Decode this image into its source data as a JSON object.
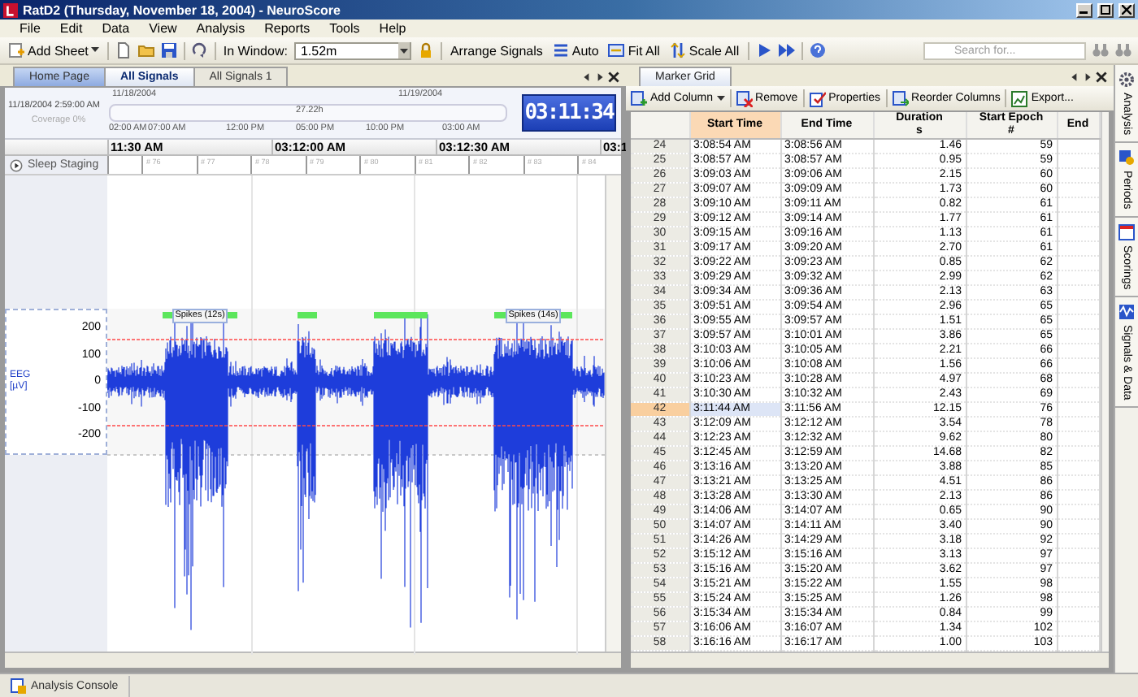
{
  "window": {
    "title": "RatD2 (Thursday, November 18, 2004) - NeuroScore"
  },
  "menu": [
    "File",
    "Edit",
    "Data",
    "View",
    "Analysis",
    "Reports",
    "Tools",
    "Help"
  ],
  "toolbar": {
    "add_sheet": "Add Sheet",
    "in_window_label": "In Window:",
    "in_window_value": "1.52m",
    "arrange": "Arrange Signals",
    "auto": "Auto",
    "fit_all": "Fit All",
    "scale_all": "Scale All",
    "search": {
      "placeholder": "Search for..."
    }
  },
  "left_tabs": [
    {
      "label": "Home Page",
      "selected": false
    },
    {
      "label": "All Signals",
      "selected": true
    },
    {
      "label": "All Signals 1",
      "selected": false
    }
  ],
  "overview": {
    "start": "11/18/2004 2:59:00 AM",
    "coverage": "Coverage 0%",
    "date_1": "11/18/2004",
    "date_2": "11/19/2004",
    "span": "27.22h",
    "ticks": [
      "02:00 AM",
      "07:00 AM",
      "12:00 PM",
      "05:00 PM",
      "10:00 PM",
      "03:00 AM"
    ],
    "clock": "03:11:34"
  },
  "time_axis": [
    "11:30 AM",
    "03:12:00 AM",
    "03:12:30 AM",
    "03:1"
  ],
  "sleep_staging": {
    "label": "Sleep Staging",
    "epochs": [
      "# 76",
      "# 77",
      "# 78",
      "# 79",
      "# 80",
      "# 81",
      "# 82",
      "# 83",
      "# 84"
    ]
  },
  "eeg": {
    "label": "EEG",
    "unit": "[µV]",
    "y_ticks": [
      "200",
      "100",
      "0",
      "-100",
      "-200"
    ],
    "markers": [
      {
        "kind": "labeled",
        "label": "Spikes (12s)"
      },
      {
        "kind": "bar"
      },
      {
        "kind": "bar"
      },
      {
        "kind": "labeled",
        "label": "Spikes (14s)"
      }
    ]
  },
  "right_tabs": [
    {
      "label": "Marker Grid",
      "selected": true
    }
  ],
  "grid_toolbar": [
    "Add Column",
    "Remove",
    "Properties",
    "Reorder Columns",
    "Export..."
  ],
  "grid": {
    "columns": [
      {
        "title": "Start Time",
        "selected": true
      },
      {
        "title": "End Time",
        "selected": false
      },
      {
        "title": "Duration",
        "unit": "s",
        "selected": false
      },
      {
        "title": "Start Epoch",
        "unit": "#",
        "selected": false
      },
      {
        "title": "End",
        "selected": false
      }
    ],
    "rows": [
      {
        "n": "24",
        "start": "3:08:54 AM",
        "end": "3:08:56 AM",
        "duration": "1.46",
        "epoch": "59",
        "selected": false
      },
      {
        "n": "25",
        "start": "3:08:57 AM",
        "end": "3:08:57 AM",
        "duration": "0.95",
        "epoch": "59",
        "selected": false
      },
      {
        "n": "26",
        "start": "3:09:03 AM",
        "end": "3:09:06 AM",
        "duration": "2.15",
        "epoch": "60",
        "selected": false
      },
      {
        "n": "27",
        "start": "3:09:07 AM",
        "end": "3:09:09 AM",
        "duration": "1.73",
        "epoch": "60",
        "selected": false
      },
      {
        "n": "28",
        "start": "3:09:10 AM",
        "end": "3:09:11 AM",
        "duration": "0.82",
        "epoch": "61",
        "selected": false
      },
      {
        "n": "29",
        "start": "3:09:12 AM",
        "end": "3:09:14 AM",
        "duration": "1.77",
        "epoch": "61",
        "selected": false
      },
      {
        "n": "30",
        "start": "3:09:15 AM",
        "end": "3:09:16 AM",
        "duration": "1.13",
        "epoch": "61",
        "selected": false
      },
      {
        "n": "31",
        "start": "3:09:17 AM",
        "end": "3:09:20 AM",
        "duration": "2.70",
        "epoch": "61",
        "selected": false
      },
      {
        "n": "32",
        "start": "3:09:22 AM",
        "end": "3:09:23 AM",
        "duration": "0.85",
        "epoch": "62",
        "selected": false
      },
      {
        "n": "33",
        "start": "3:09:29 AM",
        "end": "3:09:32 AM",
        "duration": "2.99",
        "epoch": "62",
        "selected": false
      },
      {
        "n": "34",
        "start": "3:09:34 AM",
        "end": "3:09:36 AM",
        "duration": "2.13",
        "epoch": "63",
        "selected": false
      },
      {
        "n": "35",
        "start": "3:09:51 AM",
        "end": "3:09:54 AM",
        "duration": "2.96",
        "epoch": "65",
        "selected": false
      },
      {
        "n": "36",
        "start": "3:09:55 AM",
        "end": "3:09:57 AM",
        "duration": "1.51",
        "epoch": "65",
        "selected": false
      },
      {
        "n": "37",
        "start": "3:09:57 AM",
        "end": "3:10:01 AM",
        "duration": "3.86",
        "epoch": "65",
        "selected": false
      },
      {
        "n": "38",
        "start": "3:10:03 AM",
        "end": "3:10:05 AM",
        "duration": "2.21",
        "epoch": "66",
        "selected": false
      },
      {
        "n": "39",
        "start": "3:10:06 AM",
        "end": "3:10:08 AM",
        "duration": "1.56",
        "epoch": "66",
        "selected": false
      },
      {
        "n": "40",
        "start": "3:10:23 AM",
        "end": "3:10:28 AM",
        "duration": "4.97",
        "epoch": "68",
        "selected": false
      },
      {
        "n": "41",
        "start": "3:10:30 AM",
        "end": "3:10:32 AM",
        "duration": "2.43",
        "epoch": "69",
        "selected": false
      },
      {
        "n": "42",
        "start": "3:11:44 AM",
        "end": "3:11:56 AM",
        "duration": "12.15",
        "epoch": "76",
        "selected": true
      },
      {
        "n": "43",
        "start": "3:12:09 AM",
        "end": "3:12:12 AM",
        "duration": "3.54",
        "epoch": "78",
        "selected": false
      },
      {
        "n": "44",
        "start": "3:12:23 AM",
        "end": "3:12:32 AM",
        "duration": "9.62",
        "epoch": "80",
        "selected": false
      },
      {
        "n": "45",
        "start": "3:12:45 AM",
        "end": "3:12:59 AM",
        "duration": "14.68",
        "epoch": "82",
        "selected": false
      },
      {
        "n": "46",
        "start": "3:13:16 AM",
        "end": "3:13:20 AM",
        "duration": "3.88",
        "epoch": "85",
        "selected": false
      },
      {
        "n": "47",
        "start": "3:13:21 AM",
        "end": "3:13:25 AM",
        "duration": "4.51",
        "epoch": "86",
        "selected": false
      },
      {
        "n": "48",
        "start": "3:13:28 AM",
        "end": "3:13:30 AM",
        "duration": "2.13",
        "epoch": "86",
        "selected": false
      },
      {
        "n": "49",
        "start": "3:14:06 AM",
        "end": "3:14:07 AM",
        "duration": "0.65",
        "epoch": "90",
        "selected": false
      },
      {
        "n": "50",
        "start": "3:14:07 AM",
        "end": "3:14:11 AM",
        "duration": "3.40",
        "epoch": "90",
        "selected": false
      },
      {
        "n": "51",
        "start": "3:14:26 AM",
        "end": "3:14:29 AM",
        "duration": "3.18",
        "epoch": "92",
        "selected": false
      },
      {
        "n": "52",
        "start": "3:15:12 AM",
        "end": "3:15:16 AM",
        "duration": "3.13",
        "epoch": "97",
        "selected": false
      },
      {
        "n": "53",
        "start": "3:15:16 AM",
        "end": "3:15:20 AM",
        "duration": "3.62",
        "epoch": "97",
        "selected": false
      },
      {
        "n": "54",
        "start": "3:15:21 AM",
        "end": "3:15:22 AM",
        "duration": "1.55",
        "epoch": "98",
        "selected": false
      },
      {
        "n": "55",
        "start": "3:15:24 AM",
        "end": "3:15:25 AM",
        "duration": "1.26",
        "epoch": "98",
        "selected": false
      },
      {
        "n": "56",
        "start": "3:15:34 AM",
        "end": "3:15:34 AM",
        "duration": "0.84",
        "epoch": "99",
        "selected": false
      },
      {
        "n": "57",
        "start": "3:16:06 AM",
        "end": "3:16:07 AM",
        "duration": "1.34",
        "epoch": "102",
        "selected": false
      },
      {
        "n": "58",
        "start": "3:16:16 AM",
        "end": "3:16:17 AM",
        "duration": "1.00",
        "epoch": "103",
        "selected": false
      }
    ]
  },
  "side_tabs": [
    "Analysis",
    "Periods",
    "Scorings",
    "Signals & Data"
  ],
  "status_bar": {
    "tab": "Analysis Console"
  }
}
